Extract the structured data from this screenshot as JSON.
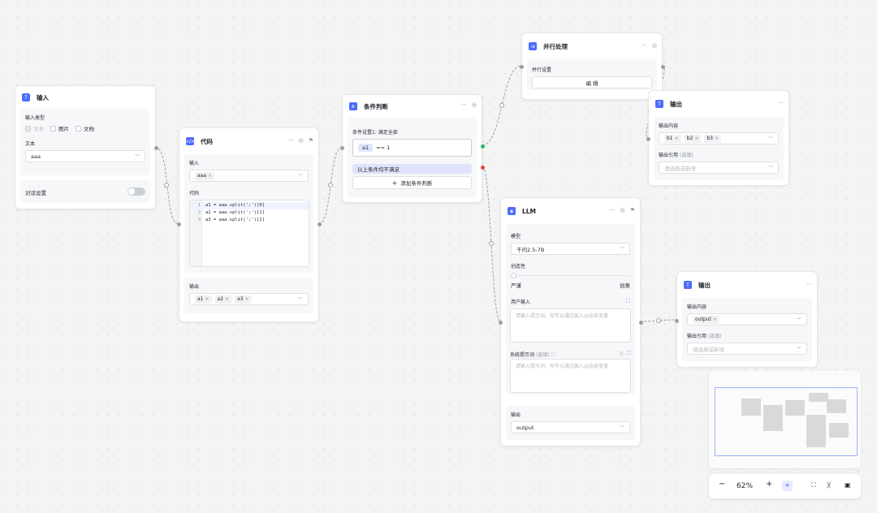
{
  "canvas": {
    "zoom": "62%"
  },
  "nodes": {
    "input": {
      "title": "输入",
      "input_type_label": "输入类型",
      "types": [
        "文本",
        "图片",
        "文档"
      ],
      "text_label": "文本",
      "text_value": "aaa",
      "dialog_settings_label": "对话设置"
    },
    "code": {
      "title": "代码",
      "input_label": "输入",
      "input_tag": "aaa",
      "code_label": "代码",
      "code_lines": [
        {
          "num": "1",
          "text": "a1 = aaa.split(';')[0]"
        },
        {
          "num": "2",
          "text": "a2 = aaa.split(';')[1]"
        },
        {
          "num": "3",
          "text": "a3 = aaa.split(';')[2]"
        }
      ],
      "output_label": "输出",
      "output_tags": [
        "a1",
        "a2",
        "a3"
      ]
    },
    "condition": {
      "title": "条件判断",
      "cond1_label": "条件设置1: 满足全部",
      "cond1_var": "a1",
      "cond1_expr": "== 1",
      "else_label": "以上条件均不满足",
      "add_label": "添加条件判断"
    },
    "parallel": {
      "title": "并行处理",
      "settings_label": "并行设置",
      "edit_label": "编 辑"
    },
    "output1": {
      "title": "输出",
      "content_label": "输出内容",
      "content_tags": [
        "b1",
        "b2",
        "b3"
      ],
      "ref_label": "输出引用",
      "ref_optional": "(选填)",
      "ref_placeholder": "请选择或新增"
    },
    "llm": {
      "title": "LLM",
      "model_label": "模型",
      "model_value": "千问2.5-7B",
      "creativity_label": "创造性",
      "strict_label": "严谨",
      "creative_label": "创意",
      "creativity_level": 0,
      "user_input_label": "用户输入",
      "user_input_placeholder": "请输入提示词，你可以通过输入@选择变量",
      "system_prompt_label": "系统提示词",
      "system_prompt_optional": "(选填)",
      "system_prompt_placeholder": "请输入提示词，你可以通过输入@选择变量",
      "output_label": "输出",
      "output_value": "output"
    },
    "output2": {
      "title": "输出",
      "content_label": "输出内容",
      "content_tags": [
        "output"
      ],
      "ref_label": "输出引用",
      "ref_optional": "(选填)",
      "ref_placeholder": "请选择或新增"
    }
  },
  "colors": {
    "accent": "#4d6bfe",
    "true_branch": "#35b36d",
    "false_branch": "#e0443e",
    "else_highlight": "#dfe4fb"
  }
}
